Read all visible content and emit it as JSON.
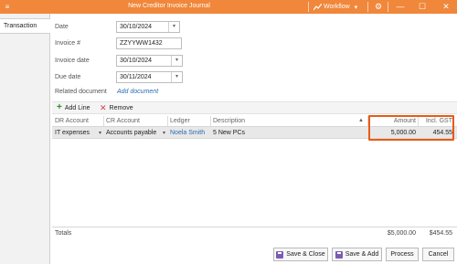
{
  "window": {
    "title": "New Creditor Invoice Journal",
    "workflow_label": "Workflow",
    "workflow_dropdown_glyph": "▾",
    "app_icon_glyph": "≡",
    "settings_glyph": "⚙",
    "minimize_glyph": "—",
    "maximize_glyph": "☐",
    "close_glyph": "✕"
  },
  "tabs": [
    {
      "label": "Transaction"
    }
  ],
  "form": {
    "date": {
      "label": "Date",
      "value": "30/10/2024"
    },
    "invoice_number": {
      "label": "Invoice #",
      "value": "ZZYYWW1432"
    },
    "invoice_date": {
      "label": "Invoice date",
      "value": "30/10/2024"
    },
    "due_date": {
      "label": "Due date",
      "value": "30/11/2024"
    },
    "related_document": {
      "label": "Related document",
      "link": "Add document"
    },
    "dropdown_glyph": "▾"
  },
  "toolbar": {
    "add_line": "Add Line",
    "remove": "Remove"
  },
  "grid": {
    "columns": [
      "DR Account",
      "CR Account",
      "Ledger",
      "Description",
      "Amount",
      "Incl. GST"
    ],
    "sort_glyph": "▲",
    "rows": [
      {
        "dr_account": "IT expenses",
        "cr_account": "Accounts payable",
        "ledger": "Noela Smith",
        "description": "5 New PCs",
        "amount": "5,000.00",
        "incl_gst": "454.55"
      }
    ]
  },
  "totals": {
    "label": "Totals",
    "amount": "$5,000.00",
    "incl_gst": "$454.55"
  },
  "buttons": {
    "save_close": "Save & Close",
    "save_add": "Save & Add",
    "process": "Process",
    "cancel": "Cancel"
  },
  "colors": {
    "titlebar": "#f0873a",
    "highlight": "#e85a16",
    "link": "#2b6cb0"
  }
}
